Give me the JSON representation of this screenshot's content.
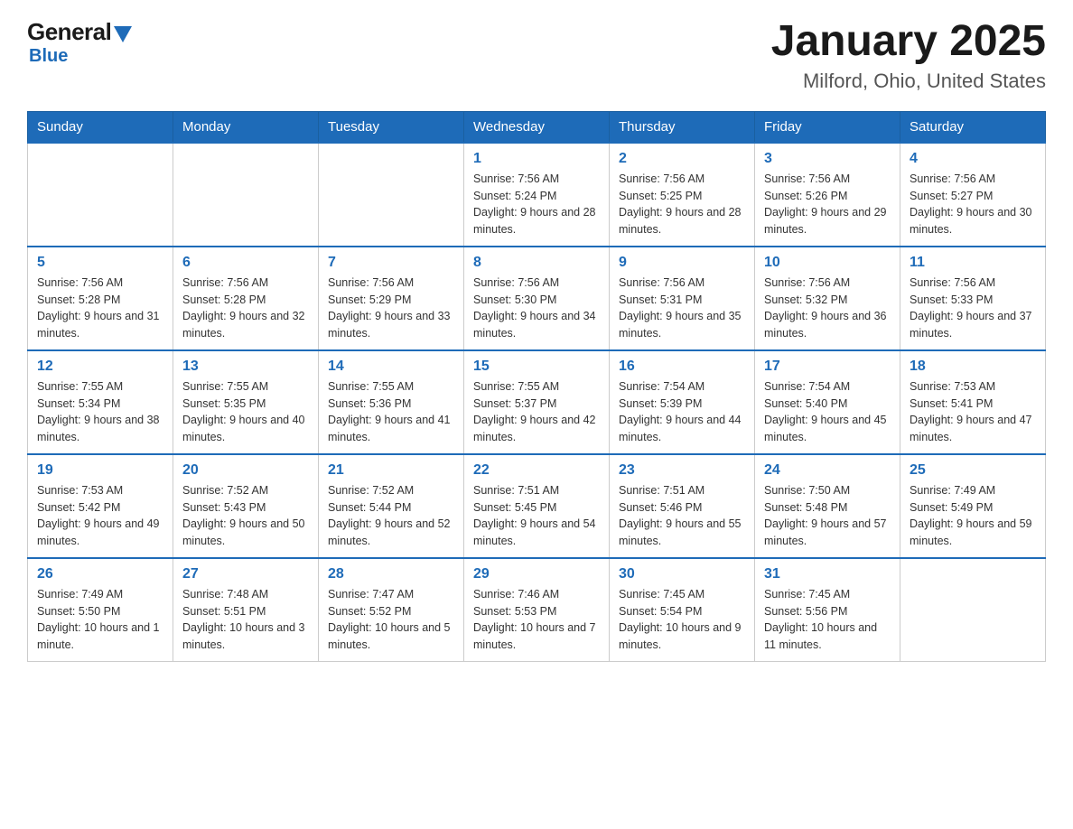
{
  "logo": {
    "general": "General",
    "blue": "Blue"
  },
  "title": "January 2025",
  "location": "Milford, Ohio, United States",
  "days_of_week": [
    "Sunday",
    "Monday",
    "Tuesday",
    "Wednesday",
    "Thursday",
    "Friday",
    "Saturday"
  ],
  "weeks": [
    [
      {
        "day": "",
        "info": ""
      },
      {
        "day": "",
        "info": ""
      },
      {
        "day": "",
        "info": ""
      },
      {
        "day": "1",
        "info": "Sunrise: 7:56 AM\nSunset: 5:24 PM\nDaylight: 9 hours and 28 minutes."
      },
      {
        "day": "2",
        "info": "Sunrise: 7:56 AM\nSunset: 5:25 PM\nDaylight: 9 hours and 28 minutes."
      },
      {
        "day": "3",
        "info": "Sunrise: 7:56 AM\nSunset: 5:26 PM\nDaylight: 9 hours and 29 minutes."
      },
      {
        "day": "4",
        "info": "Sunrise: 7:56 AM\nSunset: 5:27 PM\nDaylight: 9 hours and 30 minutes."
      }
    ],
    [
      {
        "day": "5",
        "info": "Sunrise: 7:56 AM\nSunset: 5:28 PM\nDaylight: 9 hours and 31 minutes."
      },
      {
        "day": "6",
        "info": "Sunrise: 7:56 AM\nSunset: 5:28 PM\nDaylight: 9 hours and 32 minutes."
      },
      {
        "day": "7",
        "info": "Sunrise: 7:56 AM\nSunset: 5:29 PM\nDaylight: 9 hours and 33 minutes."
      },
      {
        "day": "8",
        "info": "Sunrise: 7:56 AM\nSunset: 5:30 PM\nDaylight: 9 hours and 34 minutes."
      },
      {
        "day": "9",
        "info": "Sunrise: 7:56 AM\nSunset: 5:31 PM\nDaylight: 9 hours and 35 minutes."
      },
      {
        "day": "10",
        "info": "Sunrise: 7:56 AM\nSunset: 5:32 PM\nDaylight: 9 hours and 36 minutes."
      },
      {
        "day": "11",
        "info": "Sunrise: 7:56 AM\nSunset: 5:33 PM\nDaylight: 9 hours and 37 minutes."
      }
    ],
    [
      {
        "day": "12",
        "info": "Sunrise: 7:55 AM\nSunset: 5:34 PM\nDaylight: 9 hours and 38 minutes."
      },
      {
        "day": "13",
        "info": "Sunrise: 7:55 AM\nSunset: 5:35 PM\nDaylight: 9 hours and 40 minutes."
      },
      {
        "day": "14",
        "info": "Sunrise: 7:55 AM\nSunset: 5:36 PM\nDaylight: 9 hours and 41 minutes."
      },
      {
        "day": "15",
        "info": "Sunrise: 7:55 AM\nSunset: 5:37 PM\nDaylight: 9 hours and 42 minutes."
      },
      {
        "day": "16",
        "info": "Sunrise: 7:54 AM\nSunset: 5:39 PM\nDaylight: 9 hours and 44 minutes."
      },
      {
        "day": "17",
        "info": "Sunrise: 7:54 AM\nSunset: 5:40 PM\nDaylight: 9 hours and 45 minutes."
      },
      {
        "day": "18",
        "info": "Sunrise: 7:53 AM\nSunset: 5:41 PM\nDaylight: 9 hours and 47 minutes."
      }
    ],
    [
      {
        "day": "19",
        "info": "Sunrise: 7:53 AM\nSunset: 5:42 PM\nDaylight: 9 hours and 49 minutes."
      },
      {
        "day": "20",
        "info": "Sunrise: 7:52 AM\nSunset: 5:43 PM\nDaylight: 9 hours and 50 minutes."
      },
      {
        "day": "21",
        "info": "Sunrise: 7:52 AM\nSunset: 5:44 PM\nDaylight: 9 hours and 52 minutes."
      },
      {
        "day": "22",
        "info": "Sunrise: 7:51 AM\nSunset: 5:45 PM\nDaylight: 9 hours and 54 minutes."
      },
      {
        "day": "23",
        "info": "Sunrise: 7:51 AM\nSunset: 5:46 PM\nDaylight: 9 hours and 55 minutes."
      },
      {
        "day": "24",
        "info": "Sunrise: 7:50 AM\nSunset: 5:48 PM\nDaylight: 9 hours and 57 minutes."
      },
      {
        "day": "25",
        "info": "Sunrise: 7:49 AM\nSunset: 5:49 PM\nDaylight: 9 hours and 59 minutes."
      }
    ],
    [
      {
        "day": "26",
        "info": "Sunrise: 7:49 AM\nSunset: 5:50 PM\nDaylight: 10 hours and 1 minute."
      },
      {
        "day": "27",
        "info": "Sunrise: 7:48 AM\nSunset: 5:51 PM\nDaylight: 10 hours and 3 minutes."
      },
      {
        "day": "28",
        "info": "Sunrise: 7:47 AM\nSunset: 5:52 PM\nDaylight: 10 hours and 5 minutes."
      },
      {
        "day": "29",
        "info": "Sunrise: 7:46 AM\nSunset: 5:53 PM\nDaylight: 10 hours and 7 minutes."
      },
      {
        "day": "30",
        "info": "Sunrise: 7:45 AM\nSunset: 5:54 PM\nDaylight: 10 hours and 9 minutes."
      },
      {
        "day": "31",
        "info": "Sunrise: 7:45 AM\nSunset: 5:56 PM\nDaylight: 10 hours and 11 minutes."
      },
      {
        "day": "",
        "info": ""
      }
    ]
  ]
}
